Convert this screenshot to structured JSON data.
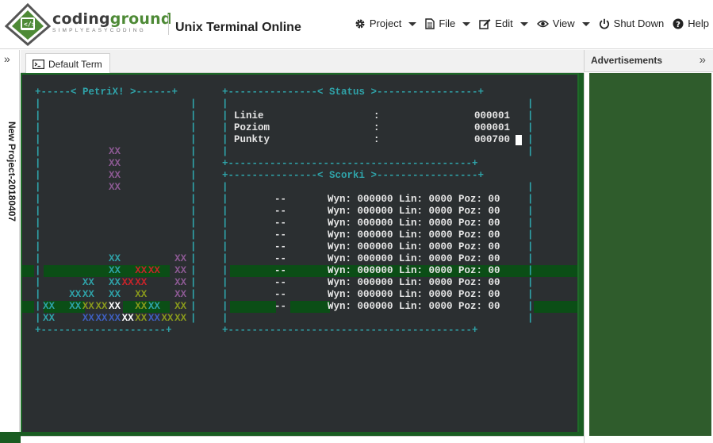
{
  "brand": {
    "name_part1": "coding",
    "name_part2": "ground",
    "tagline": "SIMPLYEASYCODING",
    "app_title": "Unix Terminal Online"
  },
  "menu": [
    {
      "key": "project",
      "label": "Project",
      "icon": "gear-icon",
      "dropdown": true
    },
    {
      "key": "file",
      "label": "File",
      "icon": "file-icon",
      "dropdown": true
    },
    {
      "key": "edit",
      "label": "Edit",
      "icon": "edit-icon",
      "dropdown": true
    },
    {
      "key": "view",
      "label": "View",
      "icon": "eye-icon",
      "dropdown": true
    },
    {
      "key": "shutdown",
      "label": "Shut Down",
      "icon": "power-icon",
      "dropdown": false
    },
    {
      "key": "help",
      "label": "Help",
      "icon": "help-icon",
      "dropdown": false
    }
  ],
  "sidebar": {
    "project_name": "New Project-20180407",
    "toggle_glyph": "»"
  },
  "tabs": [
    {
      "label": "Default Term",
      "icon": "terminal-icon",
      "active": true
    }
  ],
  "ads": {
    "title": "Advertisements",
    "toggle_glyph": "»"
  },
  "terminal": {
    "petrix_frame_top": "+-----< PetriX! >------+",
    "petrix_frame_bottom": "+---------------------+",
    "status_frame_top": "+---------------< Status >-----------------+",
    "status_frame_mid": "+-----------------------------------------+",
    "scores_frame_top": "+---------------< Scorki >-----------------+",
    "scores_frame_bottom": "+-----------------------------------------+",
    "status": [
      {
        "label": "Linie",
        "sep": ":",
        "value": "000001"
      },
      {
        "label": "Poziom",
        "sep": ":",
        "value": "000001"
      },
      {
        "label": "Punkty",
        "sep": ":",
        "value": "000700"
      }
    ],
    "scores": [
      {
        "name": "--",
        "text": "Wyn: 000000 Lin: 0000 Poz: 00"
      },
      {
        "name": "--",
        "text": "Wyn: 000000 Lin: 0000 Poz: 00"
      },
      {
        "name": "--",
        "text": "Wyn: 000000 Lin: 0000 Poz: 00"
      },
      {
        "name": "--",
        "text": "Wyn: 000000 Lin: 0000 Poz: 00"
      },
      {
        "name": "--",
        "text": "Wyn: 000000 Lin: 0000 Poz: 00"
      },
      {
        "name": "--",
        "text": "Wyn: 000000 Lin: 0000 Poz: 00"
      },
      {
        "name": "--",
        "text": "Wyn: 000000 Lin: 0000 Poz: 00"
      },
      {
        "name": "--",
        "text": "Wyn: 000000 Lin: 0000 Poz: 00"
      },
      {
        "name": "--",
        "text": "Wyn: 000000 Lin: 0000 Poz: 00"
      },
      {
        "name": "--",
        "text": "Wyn: 000000 Lin: 0000 Poz: 00"
      }
    ],
    "block_glyph": "XX",
    "colors": {
      "purple": "#8d5a94",
      "teal": "#2fa3a9",
      "red": "#c8242a",
      "olive": "#8a9a1c",
      "blue": "#3f5fc0",
      "white": "#ffffff"
    },
    "playfield": [
      {
        "row": 0,
        "cells": [
          {
            "col": 5,
            "color": "purple"
          }
        ]
      },
      {
        "row": 1,
        "cells": [
          {
            "col": 5,
            "color": "purple"
          }
        ]
      },
      {
        "row": 2,
        "cells": [
          {
            "col": 5,
            "color": "purple"
          }
        ]
      },
      {
        "row": 3,
        "cells": [
          {
            "col": 5,
            "color": "purple"
          }
        ]
      },
      {
        "row": 9,
        "cells": [
          {
            "col": 5,
            "color": "teal"
          },
          {
            "col": 10,
            "color": "purple"
          }
        ]
      },
      {
        "row": 10,
        "cells": [
          {
            "col": 5,
            "color": "teal"
          },
          {
            "col": 7,
            "color": "red"
          },
          {
            "col": 8,
            "color": "red"
          },
          {
            "col": 10,
            "color": "purple"
          }
        ]
      },
      {
        "row": 11,
        "cells": [
          {
            "col": 3,
            "color": "teal"
          },
          {
            "col": 5,
            "color": "teal"
          },
          {
            "col": 6,
            "color": "red"
          },
          {
            "col": 7,
            "color": "red"
          },
          {
            "col": 10,
            "color": "purple"
          }
        ]
      },
      {
        "row": 12,
        "cells": [
          {
            "col": 2,
            "color": "teal"
          },
          {
            "col": 3,
            "color": "teal"
          },
          {
            "col": 5,
            "color": "teal"
          },
          {
            "col": 7,
            "color": "olive"
          },
          {
            "col": 10,
            "color": "purple"
          }
        ]
      },
      {
        "row": 13,
        "cells": [
          {
            "col": 0,
            "color": "teal"
          },
          {
            "col": 2,
            "color": "teal"
          },
          {
            "col": 3,
            "color": "olive"
          },
          {
            "col": 4,
            "color": "olive"
          },
          {
            "col": 5,
            "color": "white"
          },
          {
            "col": 7,
            "color": "olive"
          },
          {
            "col": 8,
            "color": "teal"
          },
          {
            "col": 10,
            "color": "olive"
          }
        ]
      },
      {
        "row": 14,
        "cells": [
          {
            "col": 0,
            "color": "teal"
          },
          {
            "col": 3,
            "color": "blue"
          },
          {
            "col": 4,
            "color": "blue"
          },
          {
            "col": 5,
            "color": "blue"
          },
          {
            "col": 6,
            "color": "white"
          },
          {
            "col": 7,
            "color": "olive"
          },
          {
            "col": 8,
            "color": "blue"
          },
          {
            "col": 9,
            "color": "olive"
          },
          {
            "col": 10,
            "color": "olive"
          }
        ]
      }
    ]
  }
}
